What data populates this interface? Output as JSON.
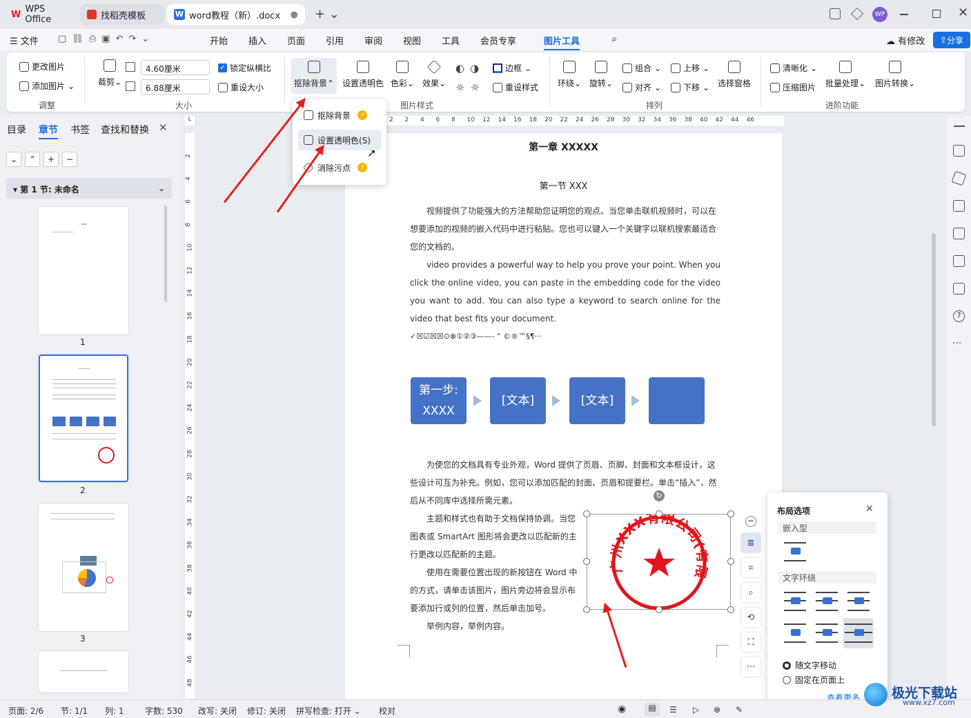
{
  "tabs": [
    {
      "label": "WPS Office"
    },
    {
      "label": "找稻壳模板"
    },
    {
      "label": "word教程（新）.docx"
    }
  ],
  "window": {
    "avatar": "WP"
  },
  "menubar": {
    "file": "文件",
    "items": [
      "开始",
      "插入",
      "页面",
      "引用",
      "审阅",
      "视图",
      "工具",
      "会员专享",
      "图片工具"
    ],
    "active": "图片工具",
    "modified": "有修改",
    "share": "分享"
  },
  "ribbon": {
    "change_pic": "更改图片",
    "add_pic": "添加图片",
    "group_adjust": "调整",
    "crop": "裁剪",
    "height_val": "4.60厘米",
    "width_val": "6.88厘米",
    "lock_ratio": "锁定纵横比",
    "reset_size": "重设大小",
    "group_size": "大小",
    "remove_bg": "抠除背景",
    "set_transparent": "设置透明色",
    "color": "色彩",
    "effect": "效果",
    "border": "边框",
    "reset_style": "重设样式",
    "group_style": "图片样式",
    "wrap": "环绕",
    "rotate": "旋转",
    "group": "组合",
    "align": "对齐",
    "up": "上移",
    "down": "下移",
    "select_pane": "选择窗格",
    "group_arrange": "排列",
    "sharpen": "清晰化",
    "compress": "压缩图片",
    "batch": "批量处理",
    "convert": "图片转换",
    "group_advanced": "进阶功能"
  },
  "dropdown": {
    "items": [
      "抠除背景",
      "设置透明色(S)",
      "消除污点"
    ]
  },
  "leftpanel": {
    "tabs": [
      "目录",
      "章节",
      "书签",
      "查找和替换"
    ],
    "active_tab": "章节",
    "section": "第 1 节: 未命名",
    "pages": [
      "1",
      "2",
      "3"
    ]
  },
  "ruler": {
    "top": [
      "2",
      "2",
      "4",
      "6",
      "8",
      "10",
      "12",
      "14",
      "16",
      "18",
      "20",
      "22",
      "24",
      "26",
      "28",
      "30",
      "32",
      "34",
      "36",
      "38",
      "40",
      "42",
      "44",
      "46"
    ],
    "left": [
      "2",
      "4",
      "6",
      "8",
      "10",
      "12",
      "14",
      "16",
      "18",
      "20",
      "22",
      "24",
      "26",
      "28",
      "30",
      "32",
      "34",
      "36",
      "38",
      "40",
      "42",
      "44",
      "46",
      "48"
    ]
  },
  "doc": {
    "chapter": "第一章  XXXXX",
    "section": "第一节  XXX",
    "p1": "视频提供了功能强大的方法帮助您证明您的观点。当您单击联机视频时，可以在想要添加的视频的嵌入代码中进行粘贴。您也可以键入一个关键字以联机搜索最适合您的文档的。",
    "p2": "video provides a powerful way to help you prove your point. When you click the online video, you can paste in the embedding code for the video you want to add. You can also type a keyword to search online for the video that best fits your document.",
    "symbols": "✓☒☑☒☒⊙⊗①②③——-    °  ©®™§¶···",
    "flow": [
      "第一步: XXXX",
      "[文本]",
      "[文本]",
      ""
    ],
    "p3": "为使您的文档具有专业外观，Word 提供了页眉、页脚、封面和文本框设计，这些设计可互为补充。例如，您可以添加匹配的封面、页眉和提要栏。单击“插入”，然后从不同库中选择所需元素。",
    "p4a": "主题和样式也有助于文档保持协调。当您",
    "p4b": "图表或 SmartArt 图形将会更改以匹配新的主",
    "p4c": "行更改以匹配新的主题。",
    "p5a": "使用在需要位置出现的新按钮在 Word 中",
    "p5b": "的方式，请单击该图片，图片旁边将会显示布",
    "p5c": "要添加行或列的位置，然后单击加号。",
    "p6": "举例内容，举例内容。",
    "stamp_text": "广州XXX有限公司(有限合伙)"
  },
  "layoutpanel": {
    "title": "布局选项",
    "inline": "嵌入型",
    "wrap": "文字环绕",
    "move_with_text": "随文字移动",
    "fix_on_page": "固定在页面上",
    "more": "查看更多"
  },
  "status": {
    "page": "页面: 2/6",
    "section": "节: 1/1",
    "col": "列: 1",
    "words": "字数: 530",
    "rev_mode": "改写: 关闭",
    "track": "修订: 关闭",
    "spell": "拼写检查: 打开",
    "proof": "校对"
  },
  "watermark": {
    "text": "极光下载站",
    "url": "www.xz7.com"
  },
  "colors": {
    "accent": "#1a6fe0",
    "flow": "#4472c4",
    "stamp": "#e0161b",
    "arrow": "#e02020"
  }
}
